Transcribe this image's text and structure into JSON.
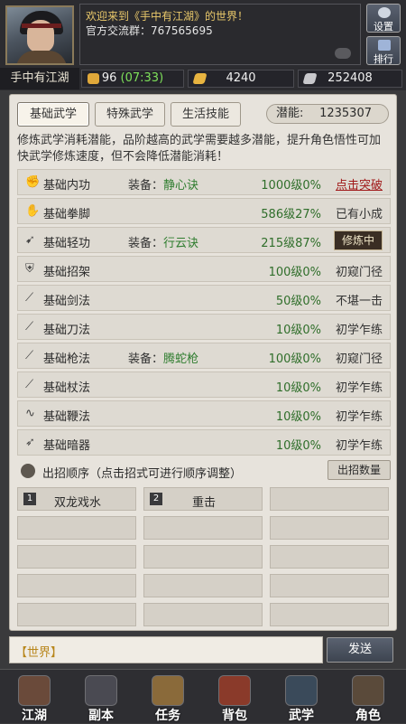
{
  "header": {
    "player_name": "手中有江湖",
    "welcome": "欢迎来到《手中有江湖》的世界！",
    "group": "官方交流群：767565695",
    "settings_label": "设置",
    "rank_label": "排行"
  },
  "resources": {
    "energy": "96",
    "energy_timer": "(07:33)",
    "gold": "4240",
    "silver": "252408"
  },
  "tabs": [
    "基础武学",
    "特殊武学",
    "生活技能"
  ],
  "potential": {
    "label": "潜能:",
    "value": "1235307"
  },
  "description": "修炼武学消耗潜能，品阶越高的武学需要越多潜能，提升角色悟性可加快武学修炼速度，但不会降低潜能消耗！",
  "skills": [
    {
      "name": "基础内功",
      "equip_label": "装备：",
      "equip": "静心诀",
      "level": "1000级0%",
      "status": "点击突破",
      "icon": "fist-icon"
    },
    {
      "name": "基础拳脚",
      "equip_label": "",
      "equip": "",
      "level": "586级27%",
      "status": "已有小成",
      "icon": "palm-icon"
    },
    {
      "name": "基础轻功",
      "equip_label": "装备：",
      "equip": "行云诀",
      "level": "215级87%",
      "status": "修炼中",
      "icon": "boot-icon"
    },
    {
      "name": "基础招架",
      "equip_label": "",
      "equip": "",
      "level": "100级0%",
      "status": "初窥门径",
      "icon": "guard-icon"
    },
    {
      "name": "基础剑法",
      "equip_label": "",
      "equip": "",
      "level": "50级0%",
      "status": "不堪一击",
      "icon": "sword-icon"
    },
    {
      "name": "基础刀法",
      "equip_label": "",
      "equip": "",
      "level": "10级0%",
      "status": "初学乍练",
      "icon": "blade-icon"
    },
    {
      "name": "基础枪法",
      "equip_label": "装备：",
      "equip": "腾蛇枪",
      "level": "100级0%",
      "status": "初窥门径",
      "icon": "spear-icon"
    },
    {
      "name": "基础杖法",
      "equip_label": "",
      "equip": "",
      "level": "10级0%",
      "status": "初学乍练",
      "icon": "staff-icon"
    },
    {
      "name": "基础鞭法",
      "equip_label": "",
      "equip": "",
      "level": "10级0%",
      "status": "初学乍练",
      "icon": "whip-icon"
    },
    {
      "name": "基础暗器",
      "equip_label": "",
      "equip": "",
      "level": "10级0%",
      "status": "初学乍练",
      "icon": "dart-icon"
    }
  ],
  "order": {
    "label": "出招顺序（点击招式可进行顺序调整）",
    "count_button": "出招数量",
    "moves": [
      {
        "num": "1",
        "name": "双龙戏水"
      },
      {
        "num": "2",
        "name": "重击"
      }
    ]
  },
  "chat": {
    "channel": "【世界】",
    "send": "发送"
  },
  "nav": [
    "江湖",
    "副本",
    "任务",
    "背包",
    "武学",
    "角色"
  ],
  "colors": {
    "accent_gold": "#e9c86a",
    "level_green": "#2f6e2a",
    "break_red": "#a01818"
  }
}
